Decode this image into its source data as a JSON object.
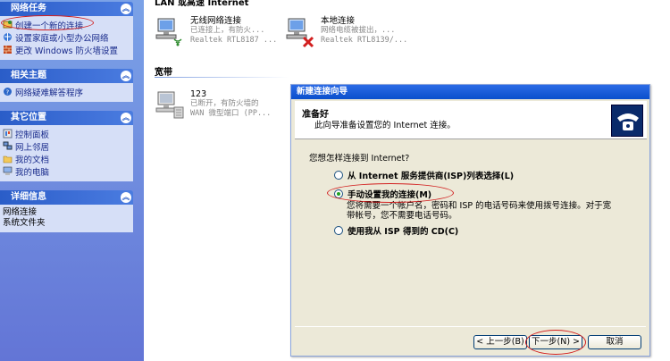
{
  "sidebar": {
    "panels": [
      {
        "title": "网络任务",
        "items": [
          "创建一个新的连接",
          "设置家庭或小型办公网络",
          "更改 Windows 防火墙设置"
        ]
      },
      {
        "title": "相关主题",
        "items": [
          "网络疑难解答程序"
        ]
      },
      {
        "title": "其它位置",
        "items": [
          "控制面板",
          "网上邻居",
          "我的文档",
          "我的电脑"
        ]
      },
      {
        "title": "详细信息",
        "details": [
          "网络连接",
          "系统文件夹"
        ]
      }
    ]
  },
  "main": {
    "lan_group_title": "LAN 或高速 Internet",
    "broadband_group_title": "宽带",
    "connections": [
      {
        "name": "无线网络连接",
        "status": "已连接上，有防火...",
        "device": "Realtek RTL8187 ..."
      },
      {
        "name": "本地连接",
        "status": "网络电缆被拔出，...",
        "device": "Realtek RTL8139/..."
      },
      {
        "name": "123",
        "status": "已断开，有防火墙的",
        "device": "WAN 微型端口 (PP..."
      }
    ]
  },
  "wizard": {
    "title": "新建连接向导",
    "header_title": "准备好",
    "header_subtitle": "此向导准备设置您的 Internet 连接。",
    "question": "您想怎样连接到 Internet?",
    "options": [
      {
        "label": "从 Internet 服务提供商(ISP)列表选择(L)",
        "selected": false
      },
      {
        "label": "手动设置我的连接(M)",
        "selected": true
      },
      {
        "label": "使用我从 ISP 得到的 CD(C)",
        "selected": false
      }
    ],
    "option_description": "您将需要一个帐户名，密码和 ISP 的电话号码来使用拨号连接。对于宽带帐号，您不需要电话号码。",
    "buttons": {
      "back": "< 上一步(B)",
      "next": "下一步(N) >",
      "cancel": "取消"
    }
  },
  "colors": {
    "sidebar_bg": "#6f8ee0",
    "panel_header": "#2a5dc8",
    "accent_red": "#d21f1f",
    "dialog_bg": "#ece9d8"
  }
}
